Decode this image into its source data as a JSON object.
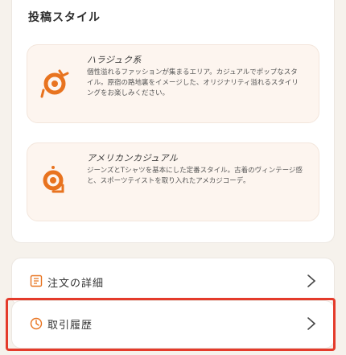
{
  "section": {
    "title": "投稿スタイル"
  },
  "styles": [
    {
      "name": "ハラジュク系",
      "description": "個性溢れるファッションが集まるエリア。カジュアルでポップなスタイル。原宿の路地裏をイメージした、オリジナリティ溢れるスタイリングをお楽しみください。",
      "icon": "person-walking-icon"
    },
    {
      "name": "アメリカンカジュアル",
      "description": "ジーンズとTシャツを基本にした定番スタイル。古着のヴィンテージ感と、スポーツテイストを取り入れたアメカジコーデ。",
      "icon": "sneaker-icon"
    }
  ],
  "menu": {
    "order_details": "注文の詳細",
    "transaction_history": "取引履歴"
  },
  "colors": {
    "accent": "#e8731f",
    "highlight": "#e43b2b",
    "card_tint": "#fdf5ef"
  }
}
